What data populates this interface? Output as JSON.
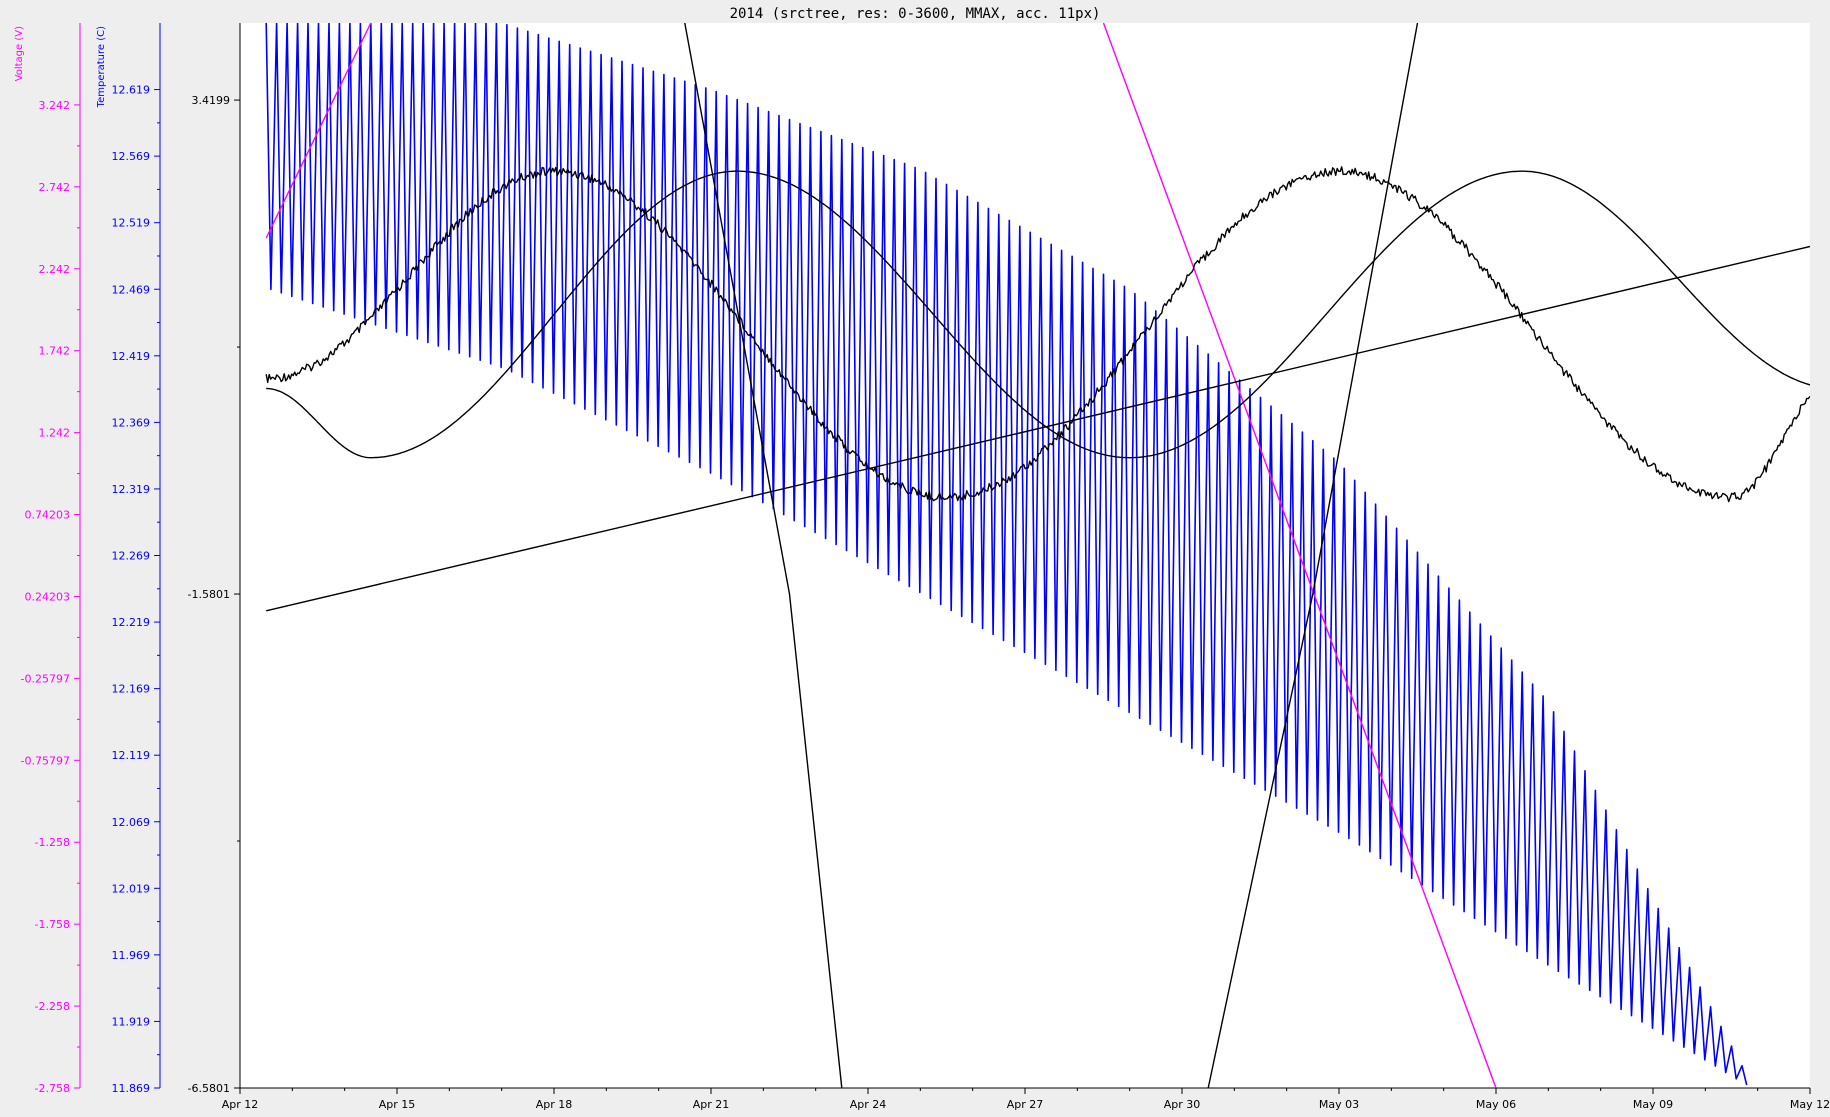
{
  "chart_data": {
    "type": "line",
    "title": "2014 (srctree, res: 0-3600, MMAX, acc. 11px)",
    "grid": false,
    "x_axis": {
      "type": "date",
      "range": [
        "2014-04-12",
        "2014-05-12"
      ],
      "tick_labels": [
        "Apr 12",
        "Apr 15",
        "Apr 18",
        "Apr 21",
        "Apr 24",
        "Apr 27",
        "Apr 30",
        "May 03",
        "May 06",
        "May 09",
        "May 12"
      ]
    },
    "y_axes": [
      {
        "id": "voltage",
        "label": "Voltage (V)",
        "color": "#ff00ff",
        "range": [
          -2.758,
          3.742
        ],
        "tick_labels": [
          "3.242",
          "2.742",
          "2.242",
          "1.742",
          "1.242",
          "0.74203",
          "0.24203",
          "-0.25797",
          "-0.75797",
          "-1.258",
          "-1.758",
          "-2.258",
          "-2.758"
        ]
      },
      {
        "id": "temperature",
        "label": "Temperature (C)",
        "color": "#0000ff",
        "range": [
          11.869,
          12.669
        ],
        "tick_labels": [
          "12.619",
          "12.569",
          "12.519",
          "12.469",
          "12.419",
          "12.369",
          "12.319",
          "12.269",
          "12.219",
          "12.169",
          "12.119",
          "12.069",
          "12.019",
          "11.969",
          "11.919",
          "11.869"
        ]
      },
      {
        "id": "main",
        "label": "",
        "color": "#000000",
        "range": [
          -6.5801,
          4.2
        ],
        "tick_labels": [
          "3.4199",
          "-1.5801",
          "-6.5801"
        ]
      }
    ],
    "series": [
      {
        "axis": "temperature",
        "color": "#0000ff",
        "style": "sawtooth oscillation, amplitude decreasing over time",
        "x": [
          "2014-04-12T12:00",
          "2014-04-17T00:00",
          "2014-04-21T00:00",
          "2014-04-25T00:00",
          "2014-04-29T00:00",
          "2014-05-03T00:00",
          "2014-05-07T00:00",
          "2014-05-10T19:00"
        ],
        "upper": [
          12.669,
          12.669,
          12.619,
          12.559,
          12.469,
          12.339,
          12.159,
          11.879
        ],
        "lower": [
          12.469,
          12.409,
          12.329,
          12.239,
          12.149,
          12.059,
          11.959,
          11.869
        ]
      },
      {
        "axis": "voltage",
        "color": "#ff00ff",
        "x": [
          "2014-04-12T12:00",
          "2014-04-14T12:00"
        ],
        "y": [
          2.43,
          3.742
        ]
      },
      {
        "axis": "voltage",
        "color": "#ff00ff",
        "x": [
          "2014-04-28T12:00",
          "2014-05-06T00:00"
        ],
        "y": [
          3.742,
          -2.758
        ]
      },
      {
        "axis": "main",
        "color": "#000000",
        "style": "noisy sinusoid",
        "x": [
          "2014-04-12T12:00",
          "2014-04-18T00:00",
          "2014-04-25T12:00",
          "2014-05-03T00:00",
          "2014-05-10T12:00",
          "2014-05-12T12:00"
        ],
        "y": [
          0.6,
          2.7,
          -0.6,
          2.7,
          -0.6,
          0.6
        ]
      },
      {
        "axis": "main",
        "color": "#000000",
        "style": "smooth sinusoid",
        "x": [
          "2014-04-12T12:00",
          "2014-04-14T12:00",
          "2014-04-21T12:00",
          "2014-04-29T00:00",
          "2014-05-06T12:00",
          "2014-05-12T12:00"
        ],
        "y": [
          0.5,
          -0.2,
          2.7,
          -0.2,
          2.7,
          0.5
        ]
      },
      {
        "axis": "main",
        "color": "#000000",
        "style": "linear trend",
        "x": [
          "2014-04-12T12:00",
          "2014-05-12T12:00"
        ],
        "y": [
          -1.75,
          2.0
        ]
      },
      {
        "axis": "main",
        "color": "#000000",
        "style": "steep descent",
        "x": [
          "2014-04-20T12:00",
          "2014-04-22T12:00",
          "2014-04-23T12:00"
        ],
        "y": [
          4.2,
          -1.58,
          -6.5801
        ]
      },
      {
        "axis": "main",
        "color": "#000000",
        "style": "steep ascent",
        "x": [
          "2014-04-30T12:00",
          "2014-05-02T12:00",
          "2014-05-04T12:00"
        ],
        "y": [
          -6.5801,
          -1.58,
          4.2
        ]
      }
    ]
  }
}
